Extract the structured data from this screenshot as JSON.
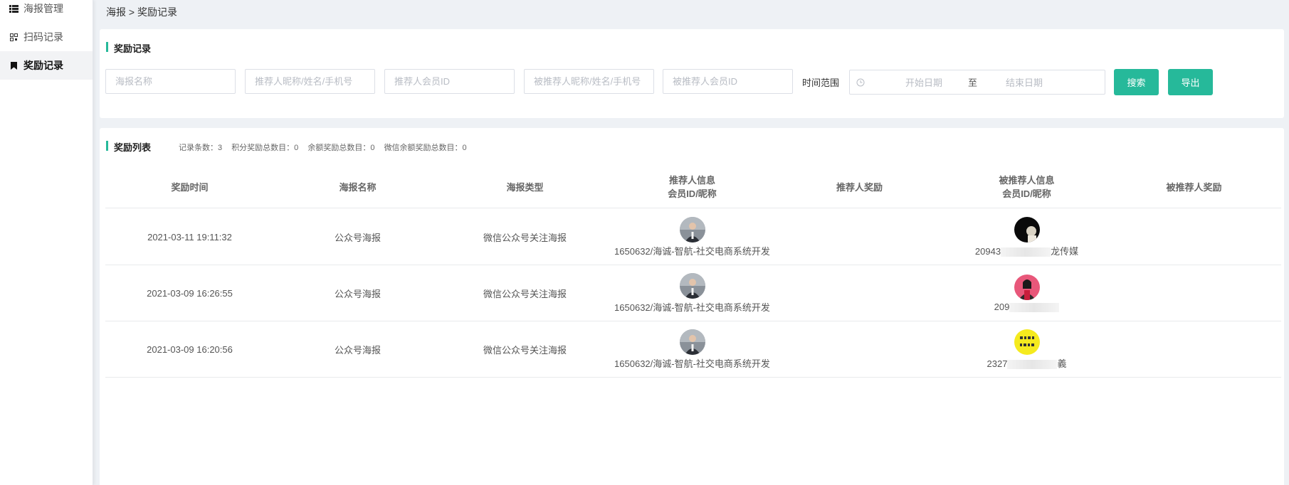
{
  "sidebar": {
    "items": [
      {
        "label": "海报管理",
        "icon": "list-icon"
      },
      {
        "label": "扫码记录",
        "icon": "qrcode-icon"
      },
      {
        "label": "奖励记录",
        "icon": "bookmark-icon"
      }
    ]
  },
  "breadcrumb": "海报 > 奖励记录",
  "filter": {
    "title": "奖励记录",
    "poster_name_placeholder": "海报名称",
    "referrer_placeholder": "推荐人昵称/姓名/手机号",
    "referrer_id_placeholder": "推荐人会员ID",
    "referee_placeholder": "被推荐人昵称/姓名/手机号",
    "referee_id_placeholder": "被推荐人会员ID",
    "time_range_label": "时间范围",
    "start_date": "开始日期",
    "separator": "至",
    "end_date": "结束日期",
    "search_label": "搜索",
    "export_label": "导出"
  },
  "list": {
    "title": "奖励列表",
    "stats": {
      "record_count": "记录条数：3",
      "points_total": "积分奖励总数目：0",
      "balance_total": "余额奖励总数目：0",
      "wechat_total": "微信余额奖励总数目：0"
    },
    "columns": {
      "time": "奖励时间",
      "poster_name": "海报名称",
      "poster_type": "海报类型",
      "referrer_line1": "推荐人信息",
      "referrer_line2": "会员ID/昵称",
      "referrer_reward": "推荐人奖励",
      "referee_line1": "被推荐人信息",
      "referee_line2": "会员ID/昵称",
      "referee_reward": "被推荐人奖励"
    },
    "rows": [
      {
        "time": "2021-03-11 19:11:32",
        "poster_name": "公众号海报",
        "poster_type": "微信公众号关注海报",
        "referrer": "1650632/海诚-智航-社交电商系统开发",
        "referee_prefix": "20943",
        "referee_suffix": "龙传媒"
      },
      {
        "time": "2021-03-09 16:26:55",
        "poster_name": "公众号海报",
        "poster_type": "微信公众号关注海报",
        "referrer": "1650632/海诚-智航-社交电商系统开发",
        "referee_prefix": "209",
        "referee_suffix": ""
      },
      {
        "time": "2021-03-09 16:20:56",
        "poster_name": "公众号海报",
        "poster_type": "微信公众号关注海报",
        "referrer": "1650632/海诚-智航-社交电商系统开发",
        "referee_prefix": "2327",
        "referee_suffix": "義"
      }
    ]
  },
  "colors": {
    "accent": "#26b99a"
  }
}
